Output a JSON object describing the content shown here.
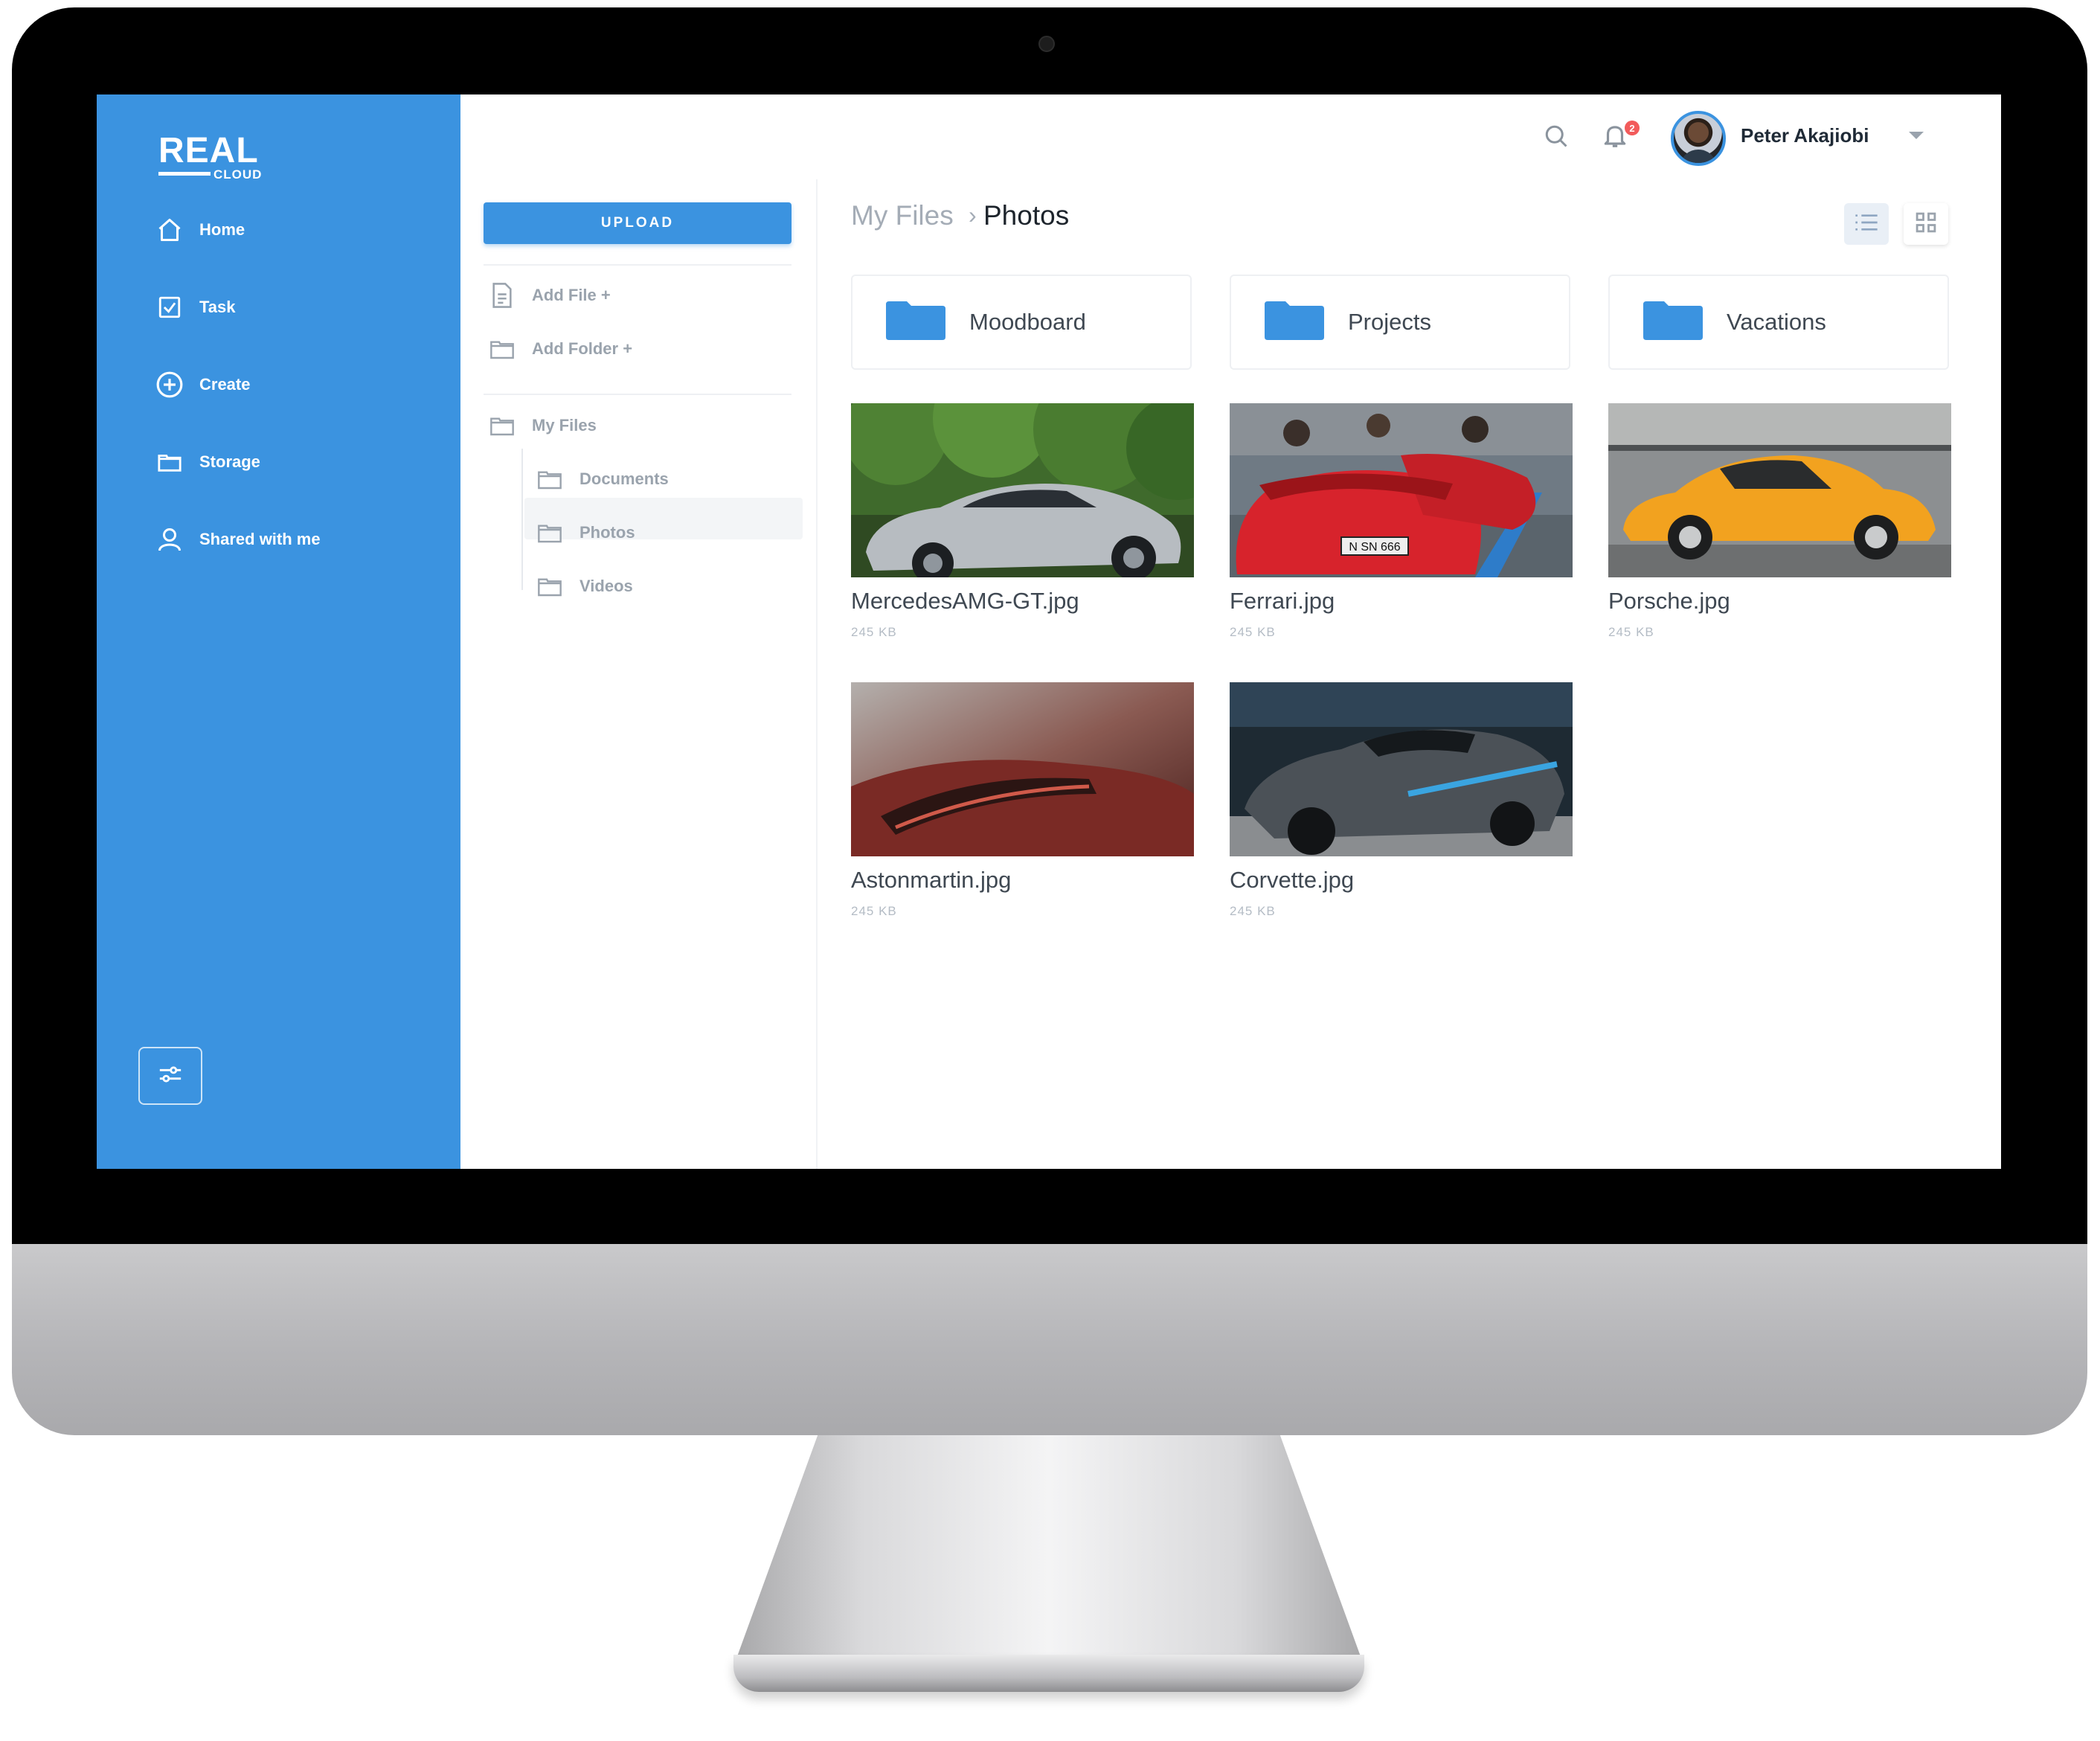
{
  "app": {
    "logo_main": "REAL",
    "logo_sub": "CLOUD",
    "accent_color": "#3b93e0"
  },
  "sidebar": {
    "items": [
      {
        "label": "Home",
        "icon": "home-icon"
      },
      {
        "label": "Task",
        "icon": "checkbox-icon"
      },
      {
        "label": "Create",
        "icon": "plus-circle-icon"
      },
      {
        "label": "Storage",
        "icon": "folder-icon"
      },
      {
        "label": "Shared with me",
        "icon": "user-icon"
      }
    ],
    "settings_icon": "sliders-icon"
  },
  "header": {
    "search_icon": "search-icon",
    "notification_icon": "bell-icon",
    "notification_count": "2",
    "user_name": "Peter Akajiobi"
  },
  "tree": {
    "upload_label": "UPLOAD",
    "add_file": "Add File +",
    "add_folder": "Add Folder +",
    "root": "My Files",
    "children": [
      {
        "label": "Documents"
      },
      {
        "label": "Photos",
        "selected": true
      },
      {
        "label": "Videos"
      }
    ]
  },
  "main": {
    "breadcrumb_root": "My Files",
    "breadcrumb_sep": "›",
    "breadcrumb_current": "Photos",
    "view_mode": "grid",
    "folders": [
      {
        "label": "Moodboard"
      },
      {
        "label": "Projects"
      },
      {
        "label": "Vacations"
      }
    ],
    "photos": [
      {
        "name": "MercedesAMG-GT.jpg",
        "size": "245 KB"
      },
      {
        "name": "Ferrari.jpg",
        "size": "245 KB"
      },
      {
        "name": "Porsche.jpg",
        "size": "245 KB"
      },
      {
        "name": "Astonmartin.jpg",
        "size": "245 KB"
      },
      {
        "name": "Corvette.jpg",
        "size": "245 KB"
      }
    ]
  }
}
